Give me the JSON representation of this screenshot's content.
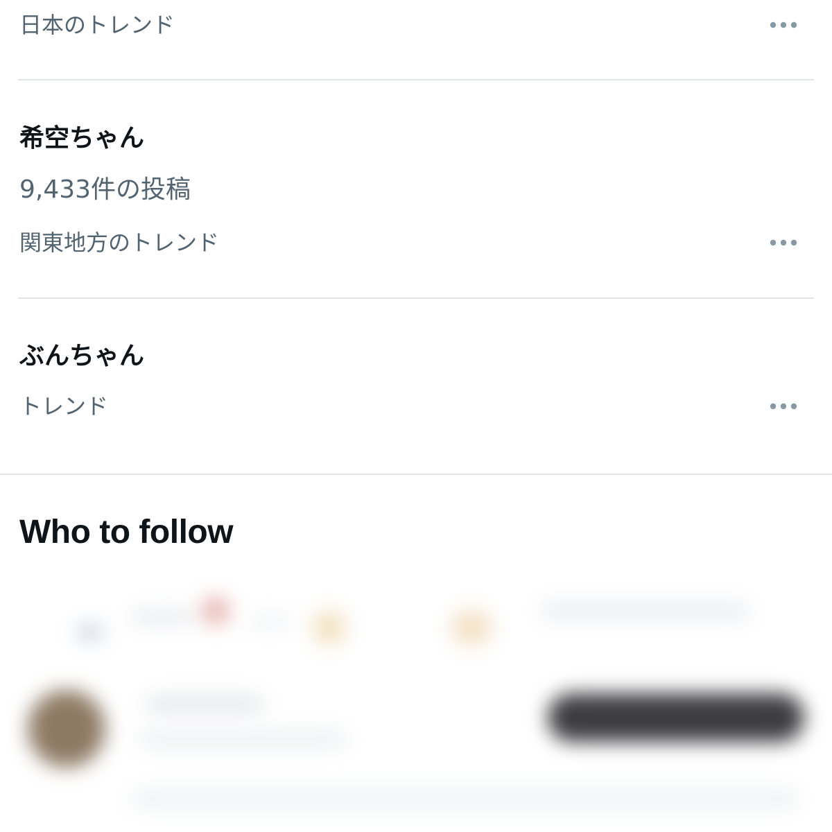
{
  "trends": [
    {
      "name": "",
      "post_count": "",
      "context": "日本のトレンド",
      "more_icon": "more-horizontal-icon"
    },
    {
      "name": "希空ちゃん",
      "post_count": "9,433件の投稿",
      "context": "関東地方のトレンド",
      "more_icon": "more-horizontal-icon"
    },
    {
      "name": "ぶんちゃん",
      "post_count": "",
      "context": "トレンド",
      "more_icon": "more-horizontal-icon"
    }
  ],
  "who_to_follow": {
    "title": "Who to follow"
  },
  "colors": {
    "primary_text": "#0f1419",
    "secondary_text": "#536471",
    "divider": "#e1e4e6",
    "more_icon": "#8899a6",
    "follow_button": "#3d3d40"
  }
}
